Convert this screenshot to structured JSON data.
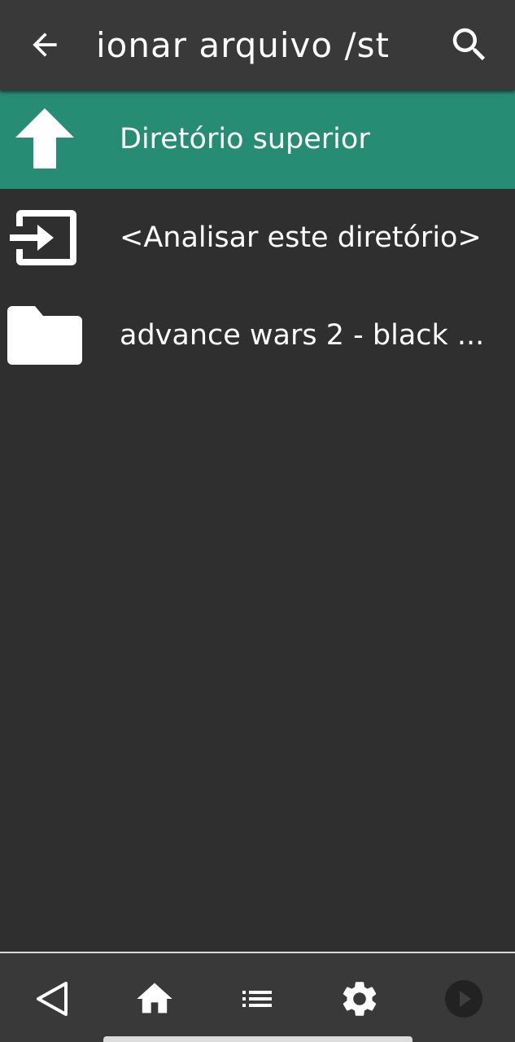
{
  "header": {
    "title": "ionar arquivo /st",
    "back_icon": "arrow-back-icon",
    "search_icon": "search-icon"
  },
  "list": {
    "items": [
      {
        "label": "Diretório superior",
        "icon": "arrow-up-icon",
        "selected": true
      },
      {
        "label": "<Analisar este diretório>",
        "icon": "scan-directory-icon",
        "selected": false
      },
      {
        "label": "advance wars 2 - black ...",
        "icon": "folder-icon",
        "selected": false
      }
    ]
  },
  "bottom_nav": {
    "items": [
      {
        "icon": "back-triangle-icon"
      },
      {
        "icon": "home-icon"
      },
      {
        "icon": "list-icon"
      },
      {
        "icon": "gear-icon"
      },
      {
        "icon": "play-icon",
        "disabled": true
      }
    ]
  },
  "colors": {
    "background": "#2f2f2f",
    "toolbar": "#393939",
    "selected_row": "#268c74",
    "text": "#ffffff"
  }
}
